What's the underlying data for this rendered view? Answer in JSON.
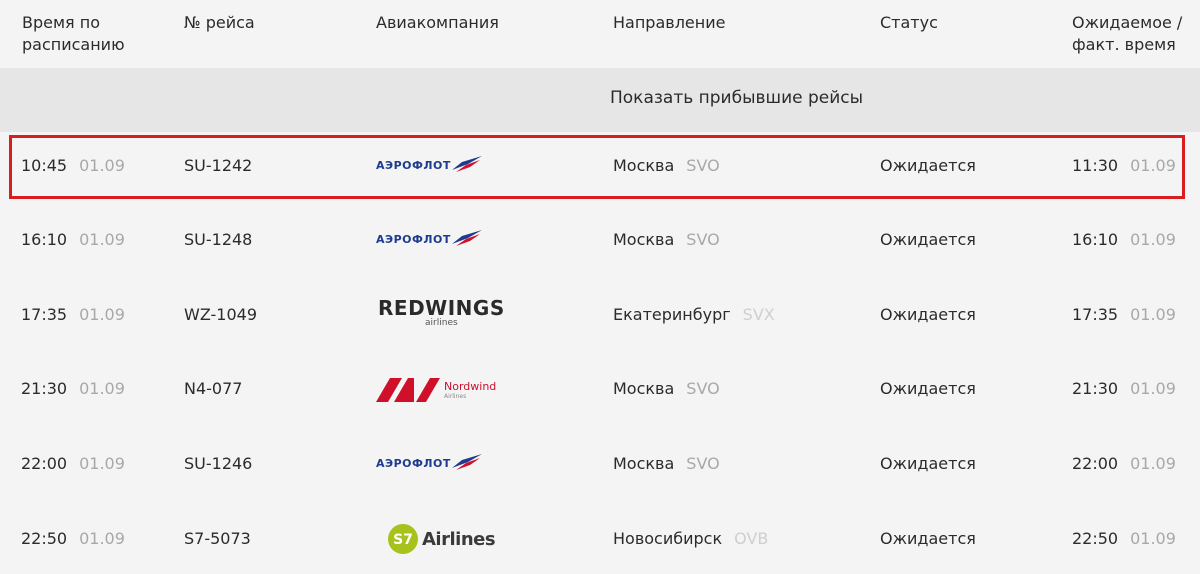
{
  "header": {
    "scheduled": "Время по расписанию",
    "flight_no": "№ рейса",
    "airline": "Авиакомпания",
    "direction": "Направление",
    "status": "Статус",
    "expected": "Ожидаемое / факт. время"
  },
  "show_arrived_label": "Показать прибывшие рейсы",
  "flights": [
    {
      "time": "10:45",
      "date": "01.09",
      "flight": "SU-1242",
      "airline_icon": "aeroflot-logo",
      "airline_text": "АЭРОФЛОТ",
      "city": "Москва",
      "code": "SVO",
      "status": "Ожидается",
      "exp_time": "11:30",
      "exp_date": "01.09",
      "highlighted": true
    },
    {
      "time": "16:10",
      "date": "01.09",
      "flight": "SU-1248",
      "airline_icon": "aeroflot-logo",
      "airline_text": "АЭРОФЛОТ",
      "city": "Москва",
      "code": "SVO",
      "status": "Ожидается",
      "exp_time": "16:10",
      "exp_date": "01.09"
    },
    {
      "time": "17:35",
      "date": "01.09",
      "flight": "WZ-1049",
      "airline_icon": "redwings-logo",
      "airline_text": "REDWINGS",
      "airline_sub": "airlines",
      "city": "Екатеринбург",
      "code": "SVX",
      "status": "Ожидается",
      "exp_time": "17:35",
      "exp_date": "01.09"
    },
    {
      "time": "21:30",
      "date": "01.09",
      "flight": "N4-077",
      "airline_icon": "nordwind-logo",
      "airline_text": "Nordwind",
      "airline_sub": "Airlines",
      "city": "Москва",
      "code": "SVO",
      "status": "Ожидается",
      "exp_time": "21:30",
      "exp_date": "01.09"
    },
    {
      "time": "22:00",
      "date": "01.09",
      "flight": "SU-1246",
      "airline_icon": "aeroflot-logo",
      "airline_text": "АЭРОФЛОТ",
      "city": "Москва",
      "code": "SVO",
      "status": "Ожидается",
      "exp_time": "22:00",
      "exp_date": "01.09"
    },
    {
      "time": "22:50",
      "date": "01.09",
      "flight": "S7-5073",
      "airline_icon": "s7-logo",
      "airline_text": "Airlines",
      "airline_badge": "S7",
      "city": "Новосибирск",
      "code": "OVB",
      "status": "Ожидается",
      "exp_time": "22:50",
      "exp_date": "01.09"
    }
  ],
  "colors": {
    "background": "#f4f4f4",
    "banner": "#e6e6e6",
    "highlight": "#d81e1e",
    "muted_text": "#a8a8a8",
    "aeroflot_blue": "#1d3b8f",
    "redwings_red": "#d0102a",
    "nordwind_red": "#c8102e",
    "s7_green": "#a6c21b"
  }
}
